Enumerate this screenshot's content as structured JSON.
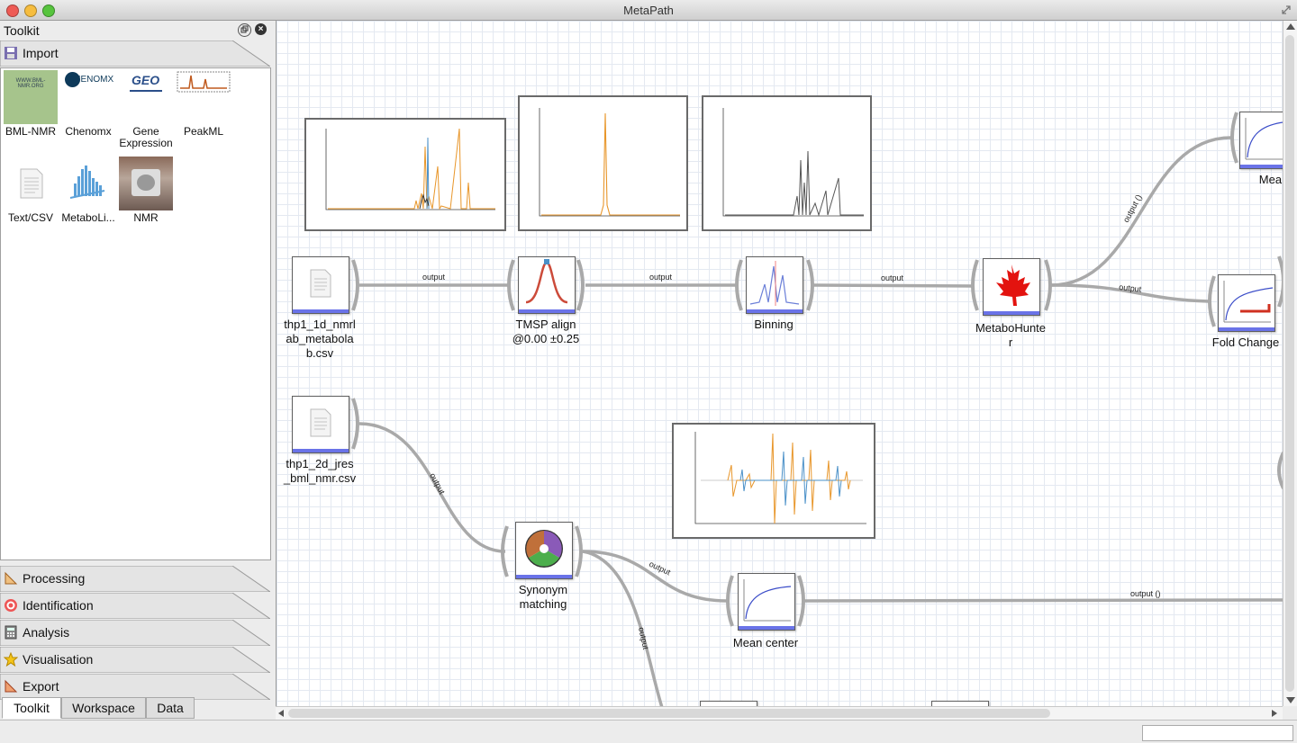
{
  "window": {
    "title": "MetaPath"
  },
  "toolkit": {
    "title": "Toolkit",
    "sections": {
      "import": "Import",
      "processing": "Processing",
      "identification": "Identification",
      "analysis": "Analysis",
      "visualisation": "Visualisation",
      "export": "Export"
    },
    "tools": [
      {
        "name": "BML-NMR",
        "icon": "bml-nmr-icon",
        "logo_text": "WWW.BML-NMR.ORG"
      },
      {
        "name": "Chenomx",
        "icon": "chenomx-icon",
        "logo_text": "CHENOMX"
      },
      {
        "name": "Gene\nExpression",
        "icon": "geo-icon",
        "logo_text": "GEO"
      },
      {
        "name": "PeakML",
        "icon": "peakml-icon"
      },
      {
        "name": "Text/CSV",
        "icon": "document-icon"
      },
      {
        "name": "MetaboLi...",
        "icon": "metabolights-icon"
      },
      {
        "name": "NMR",
        "icon": "nmr-machine-icon"
      }
    ],
    "bottom_tabs": [
      "Toolkit",
      "Workspace",
      "Data"
    ],
    "active_tab": "Toolkit"
  },
  "workflow": {
    "nodes": {
      "file1": "thp1_1d_nmrl\nab_metabola\nb.csv",
      "tmsp": "TMSP align\n@0.00 ±0.25",
      "binning": "Binning",
      "metabohunter": "MetaboHunte\nr",
      "mean_center_top": "Mean cer",
      "fold_change": "Fold Change",
      "file2": "thp1_2d_jres\n_bml_nmr.csv",
      "synonym": "Synonym\nmatching",
      "mean_center": "Mean center"
    },
    "edges": {
      "e1": "output",
      "e2": "output",
      "e3": "output",
      "e4": "output ()",
      "e5": "output",
      "e6": "output",
      "e7": "output",
      "e8": "output ()",
      "e9": "output"
    }
  },
  "colors": {
    "accent_bar": "#6a73e8",
    "spectrum_orange": "#e8962a",
    "spectrum_blue": "#4a90c8",
    "maple_red": "#e3130f"
  }
}
